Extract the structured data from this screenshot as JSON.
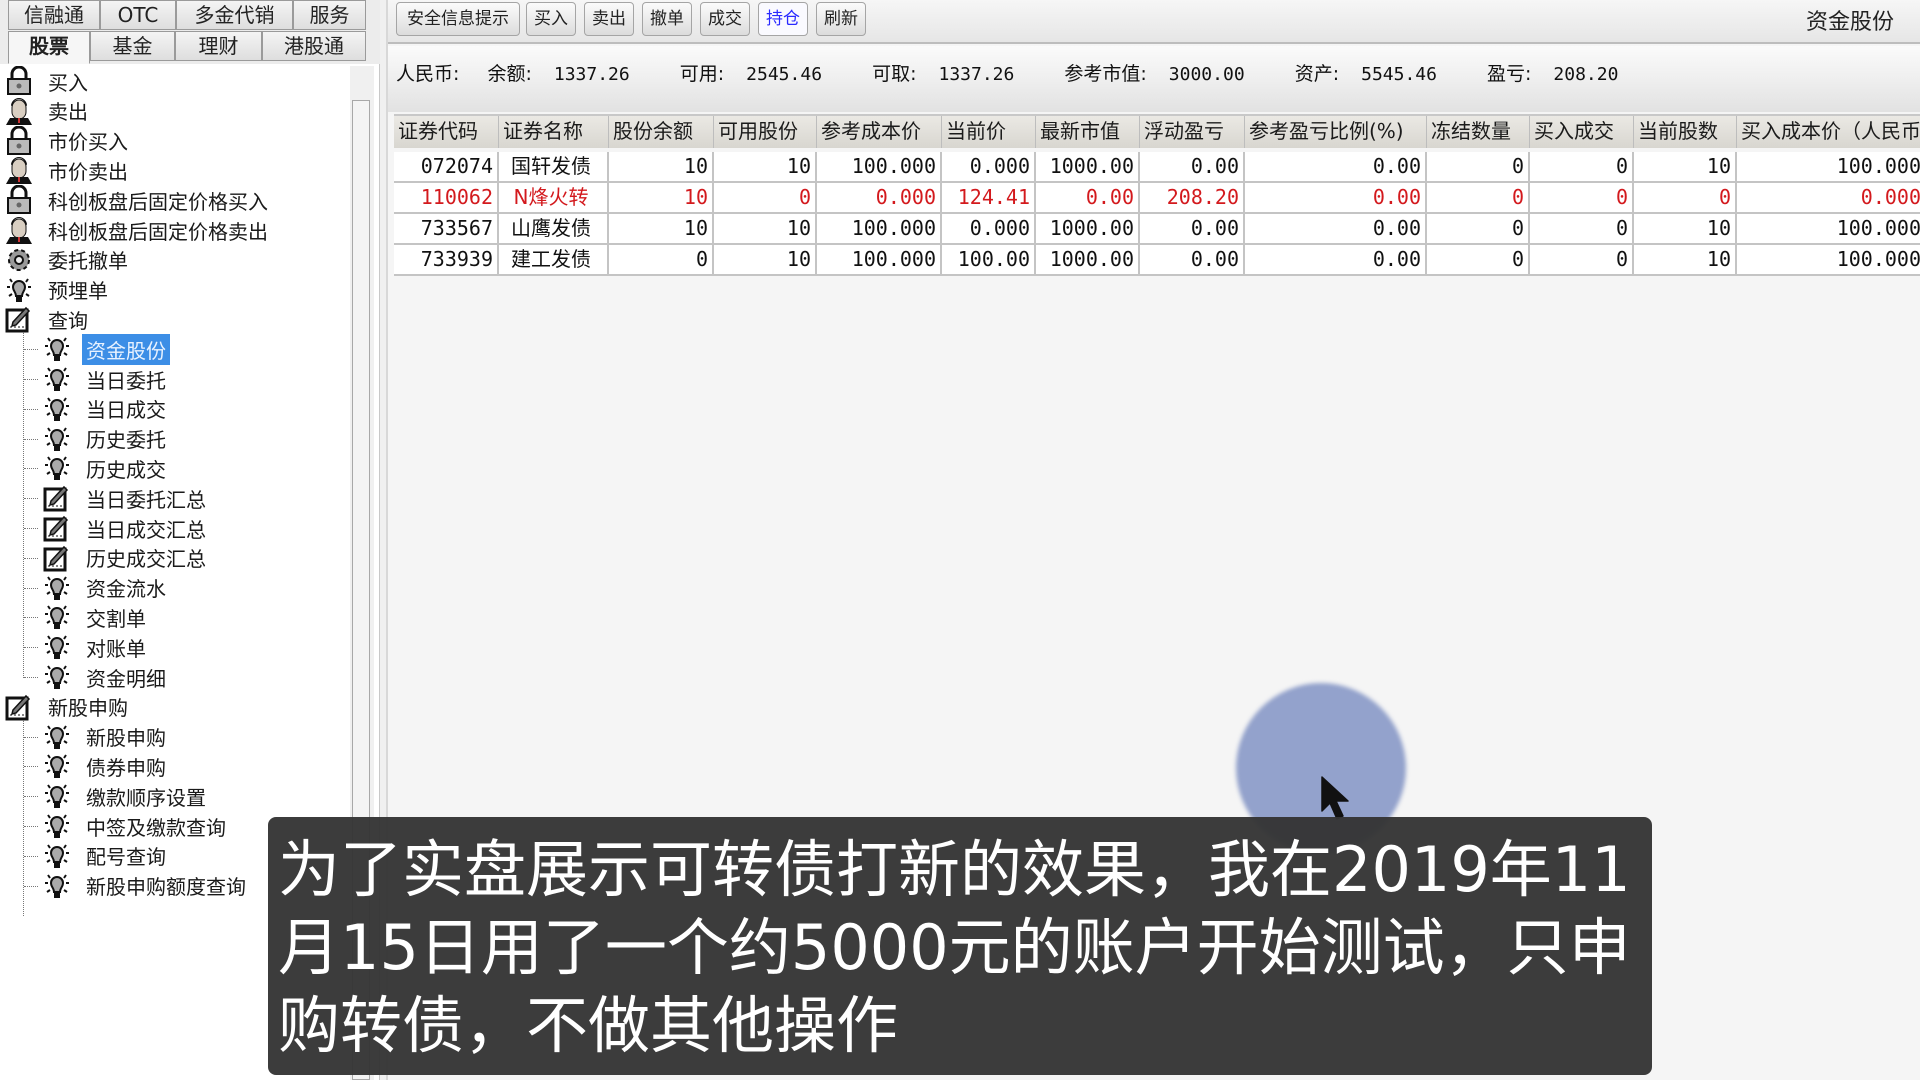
{
  "sidebar": {
    "tabs_row1": [
      {
        "label": "信融通"
      },
      {
        "label": "OTC"
      },
      {
        "label": "多金代销"
      },
      {
        "label": "服务"
      }
    ],
    "tabs_row2": [
      {
        "label": "股票",
        "selected": true
      },
      {
        "label": "基金"
      },
      {
        "label": "理财"
      },
      {
        "label": "港股通"
      }
    ],
    "tree": [
      {
        "label": "买入",
        "icon": "lock-icon",
        "level": 0
      },
      {
        "label": "卖出",
        "icon": "person-icon",
        "level": 0
      },
      {
        "label": "市价买入",
        "icon": "lock-icon",
        "level": 0
      },
      {
        "label": "市价卖出",
        "icon": "person-icon",
        "level": 0
      },
      {
        "label": "科创板盘后固定价格买入",
        "icon": "lock-icon",
        "level": 0
      },
      {
        "label": "科创板盘后固定价格卖出",
        "icon": "person-icon",
        "level": 0
      },
      {
        "label": "委托撤单",
        "icon": "gear-icon",
        "level": 0
      },
      {
        "label": "预埋单",
        "icon": "bulb-icon",
        "level": 0
      },
      {
        "label": "查询",
        "icon": "edit-icon",
        "level": 0
      },
      {
        "label": "资金股份",
        "icon": "bulb-icon",
        "level": 1,
        "selected": true
      },
      {
        "label": "当日委托",
        "icon": "bulb-icon",
        "level": 1
      },
      {
        "label": "当日成交",
        "icon": "bulb-icon",
        "level": 1
      },
      {
        "label": "历史委托",
        "icon": "bulb-icon",
        "level": 1
      },
      {
        "label": "历史成交",
        "icon": "bulb-icon",
        "level": 1
      },
      {
        "label": "当日委托汇总",
        "icon": "edit-icon",
        "level": 1
      },
      {
        "label": "当日成交汇总",
        "icon": "edit-icon",
        "level": 1
      },
      {
        "label": "历史成交汇总",
        "icon": "edit-icon",
        "level": 1
      },
      {
        "label": "资金流水",
        "icon": "bulb-icon",
        "level": 1
      },
      {
        "label": "交割单",
        "icon": "bulb-icon",
        "level": 1
      },
      {
        "label": "对账单",
        "icon": "bulb-icon",
        "level": 1
      },
      {
        "label": "资金明细",
        "icon": "bulb-icon",
        "level": 1
      },
      {
        "label": "新股申购",
        "icon": "edit-icon",
        "level": 0
      },
      {
        "label": "新股申购",
        "icon": "bulb-icon",
        "level": 1
      },
      {
        "label": "债券申购",
        "icon": "bulb-icon",
        "level": 1
      },
      {
        "label": "缴款顺序设置",
        "icon": "bulb-icon",
        "level": 1
      },
      {
        "label": "中签及缴款查询",
        "icon": "bulb-icon",
        "level": 1
      },
      {
        "label": "配号查询",
        "icon": "bulb-icon",
        "level": 1
      },
      {
        "label": "新股申购额度查询",
        "icon": "bulb-icon",
        "level": 1
      }
    ]
  },
  "toolbar": {
    "buttons": [
      {
        "label": "安全信息提示"
      },
      {
        "label": "买入"
      },
      {
        "label": "卖出"
      },
      {
        "label": "撤单"
      },
      {
        "label": "成交"
      },
      {
        "label": "持仓",
        "active": true
      },
      {
        "label": "刷新"
      }
    ],
    "page_name": "资金股份"
  },
  "summary": {
    "currency": "人民币:",
    "items": [
      {
        "label": "余额:",
        "value": "1337.26"
      },
      {
        "label": "可用:",
        "value": "2545.46"
      },
      {
        "label": "可取:",
        "value": "1337.26"
      },
      {
        "label": "参考市值:",
        "value": "3000.00"
      },
      {
        "label": "资产:",
        "value": "5545.46"
      },
      {
        "label": "盈亏:",
        "value": "208.20"
      }
    ]
  },
  "table": {
    "columns": [
      "证券代码",
      "证券名称",
      "股份余额",
      "可用股份",
      "参考成本价",
      "当前价",
      "最新市值",
      "浮动盈亏",
      "参考盈亏比例(%)",
      "冻结数量",
      "买入成交",
      "当前股数",
      "买入成本价（人民币）"
    ],
    "rows": [
      {
        "highlight": false,
        "cells": [
          "072074",
          "国轩发债",
          "10",
          "10",
          "100.000",
          "0.000",
          "1000.00",
          "0.00",
          "0.00",
          "0",
          "0",
          "10",
          "100.000"
        ]
      },
      {
        "highlight": true,
        "cells": [
          "110062",
          "N烽火转",
          "10",
          "0",
          "0.000",
          "124.41",
          "0.00",
          "208.20",
          "0.00",
          "0",
          "0",
          "0",
          "0.000"
        ]
      },
      {
        "highlight": false,
        "cells": [
          "733567",
          "山鹰发债",
          "10",
          "10",
          "100.000",
          "0.000",
          "1000.00",
          "0.00",
          "0.00",
          "0",
          "0",
          "10",
          "100.000"
        ]
      },
      {
        "highlight": false,
        "cells": [
          "733939",
          "建工发债",
          "0",
          "10",
          "100.000",
          "100.00",
          "1000.00",
          "0.00",
          "0.00",
          "0",
          "0",
          "10",
          "100.000"
        ]
      }
    ]
  },
  "colors": {
    "highlight_row": "#d3191d",
    "selected_item": "#3c8ee6",
    "active_button": "#2a2aff",
    "caption_bg": "#343434"
  },
  "caption": {
    "text": "为了实盘展示可转债打新的效果，我在2019年11月15日用了一个约5000元的账户开始测试，只申购转债，不做其他操作"
  }
}
